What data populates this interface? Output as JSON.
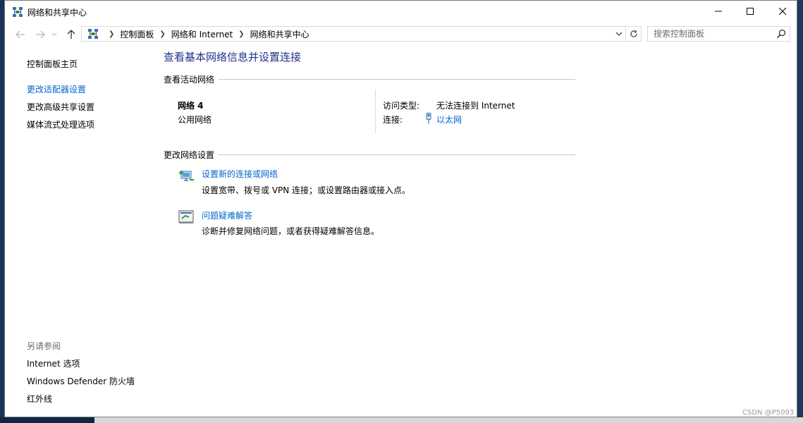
{
  "window": {
    "title": "网络和共享中心"
  },
  "address": {
    "crumbs": [
      "控制面板",
      "网络和 Internet",
      "网络和共享中心"
    ]
  },
  "search": {
    "placeholder": "搜索控制面板"
  },
  "left_pane": {
    "home": "控制面板主页",
    "links": [
      "更改适配器设置",
      "更改高级共享设置",
      "媒体流式处理选项"
    ],
    "see_also_label": "另请参阅",
    "see_also": [
      "Internet 选项",
      "Windows Defender 防火墙",
      "红外线"
    ]
  },
  "main": {
    "title": "查看基本网络信息并设置连接",
    "active_networks_label": "查看活动网络",
    "network": {
      "name": "网络 4",
      "category": "公用网络",
      "access_type_label": "访问类型:",
      "access_type_value": "无法连接到 Internet",
      "connections_label": "连接:",
      "connections_value": "以太网"
    },
    "change_settings_label": "更改网络设置",
    "tasks": [
      {
        "link": "设置新的连接或网络",
        "desc": "设置宽带、拨号或 VPN 连接；或设置路由器或接入点。",
        "icon": "network-setup-icon"
      },
      {
        "link": "问题疑难解答",
        "desc": "诊断并修复网络问题，或者获得疑难解答信息。",
        "icon": "troubleshoot-icon"
      }
    ]
  },
  "watermark": "CSDN @P5093",
  "colors": {
    "link": "#0066cc",
    "title": "#1e3287"
  }
}
